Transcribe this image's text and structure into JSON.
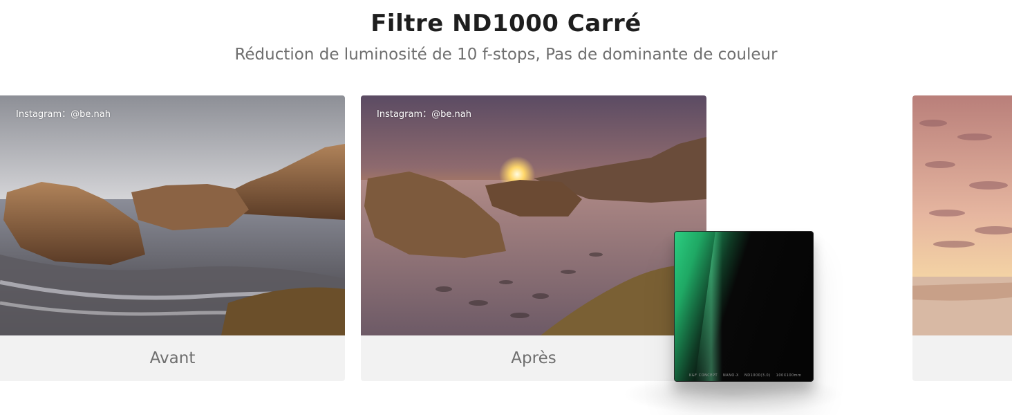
{
  "header": {
    "title": "Filtre ND1000 Carré",
    "subtitle": "Réduction de luminosité de 10 f-stops, Pas de dominante de couleur"
  },
  "cards": [
    {
      "credit": "Instagram：@be.nah",
      "caption": "Avant"
    },
    {
      "credit": "Instagram：@be.nah",
      "caption": "Après"
    },
    {
      "credit": "",
      "caption": ""
    }
  ],
  "filter": {
    "brand": "K&F CONCEPT",
    "series": "NANO-X",
    "model": "ND1000(3.0)",
    "size": "100X100mm",
    "glass_color": "#0a0a0a",
    "accent_color": "#27c27a"
  }
}
